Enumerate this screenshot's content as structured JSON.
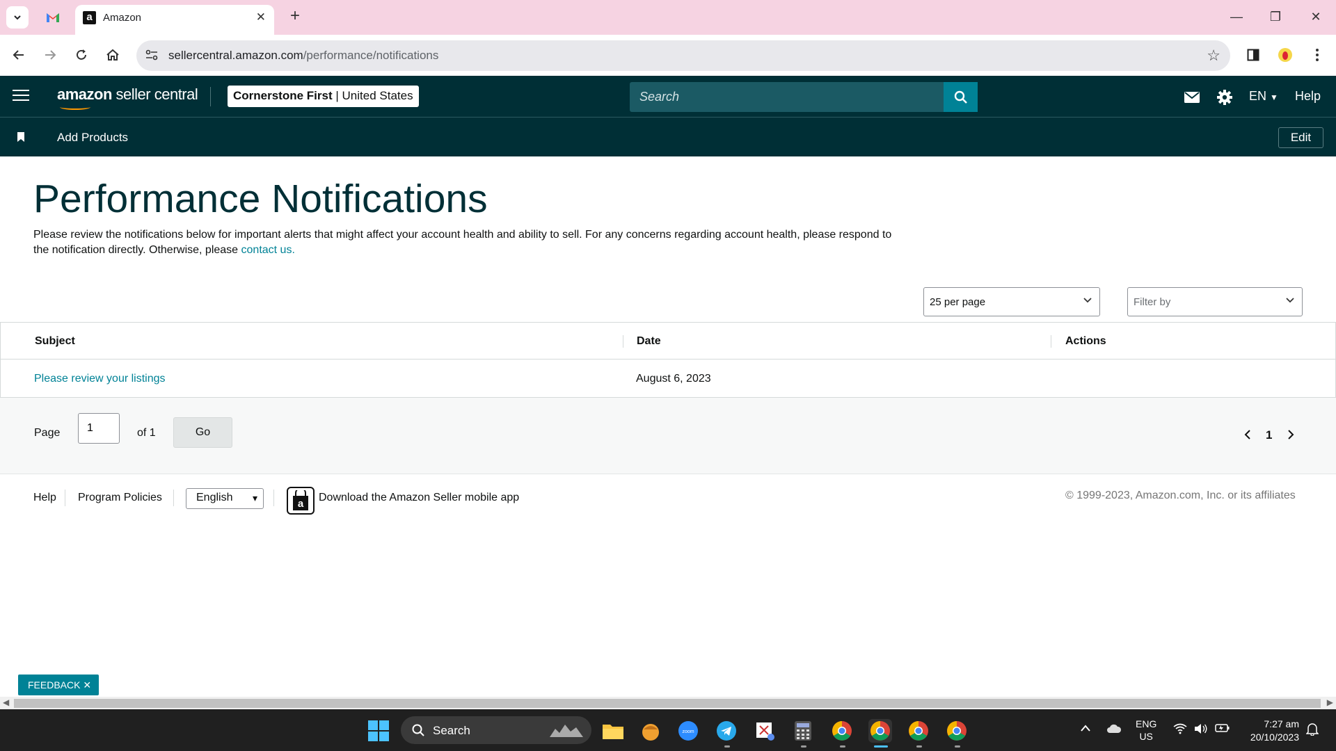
{
  "browser": {
    "tab_title": "Amazon",
    "tab_favicon": "a",
    "url_domain": "sellercentral.amazon.com",
    "url_path": "/performance/notifications",
    "colors": {
      "tabbar": "#f6d3e2",
      "omnibox": "#e8e8ec"
    }
  },
  "header": {
    "logo_main": "amazon",
    "logo_sub": " seller central",
    "account_name": "Cornerstone First",
    "account_region": "United States",
    "search_placeholder": "Search",
    "language": "EN",
    "help": "Help",
    "colors": {
      "background": "#002f36",
      "accent": "#008296"
    }
  },
  "subnav": {
    "bookmark_label": "Add Products",
    "edit_label": "Edit"
  },
  "main": {
    "title": "Performance Notifications",
    "intro_text": "Please review the notifications below for important alerts that might affect your account health and ability to sell. For any concerns regarding account health, please respond to the notification directly. Otherwise, please ",
    "intro_link": "contact us.",
    "per_page": "25 per page",
    "filter_placeholder": "Filter by"
  },
  "table": {
    "columns": [
      "Subject",
      "Date",
      "Actions"
    ],
    "rows": [
      {
        "subject": "Please review your listings",
        "date": "August 6, 2023",
        "actions": ""
      }
    ]
  },
  "pager": {
    "page_label": "Page",
    "page_value": "1",
    "of_label": "of 1",
    "go_label": "Go",
    "current_page": "1"
  },
  "footer": {
    "help": "Help",
    "program_policies": "Program Policies",
    "language": "English",
    "app_text": "Download the Amazon Seller mobile app",
    "copyright": "© 1999-2023, Amazon.com, Inc. or its affiliates"
  },
  "feedback": {
    "label": "FEEDBACK"
  },
  "taskbar": {
    "search_label": "Search",
    "lang_top": "ENG",
    "lang_bottom": "US",
    "time": "7:27 am",
    "date": "20/10/2023"
  }
}
